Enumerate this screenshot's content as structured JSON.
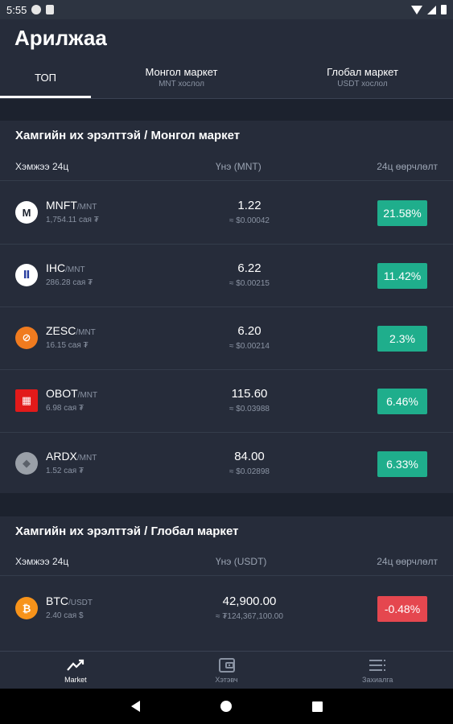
{
  "status_bar": {
    "time": "5:55"
  },
  "header": {
    "title": "Арилжаа"
  },
  "tabs": [
    {
      "label": "ТОП",
      "sub": ""
    },
    {
      "label": "Монгол маркет",
      "sub": "MNT хослол"
    },
    {
      "label": "Глобал маркет",
      "sub": "USDT хослол"
    }
  ],
  "sections": [
    {
      "title": "Хамгийн их эрэлттэй / Монгол маркет",
      "col_volume": "Хэмжээ 24ц",
      "col_price": "Үнэ (MNT)",
      "col_change": "24ц өөрчлөлт",
      "rows": [
        {
          "symbol": "MNFT",
          "pair": "/MNT",
          "volume": "1,754.11 сая ₮",
          "price": "1.22",
          "usd": "≈ $0.00042",
          "change": "21.58%",
          "direction": "up",
          "logo_icon": "mnft-logo-icon",
          "logo_bg": "#ffffff",
          "logo_fg": "#1c222e",
          "logo_glyph": "M"
        },
        {
          "symbol": "IHC",
          "pair": "/MNT",
          "volume": "286.28 сая ₮",
          "price": "6.22",
          "usd": "≈ $0.00215",
          "change": "11.42%",
          "direction": "up",
          "logo_icon": "ihc-logo-icon",
          "logo_bg": "#ffffff",
          "logo_fg": "#2a3fa0",
          "logo_glyph": "Ⅱ"
        },
        {
          "symbol": "ZESC",
          "pair": "/MNT",
          "volume": "16.15 сая ₮",
          "price": "6.20",
          "usd": "≈ $0.00214",
          "change": "2.3%",
          "direction": "up",
          "logo_icon": "zesc-logo-icon",
          "logo_bg": "#f07b1f",
          "logo_fg": "#ffffff",
          "logo_glyph": "⊘"
        },
        {
          "symbol": "OBOT",
          "pair": "/MNT",
          "volume": "6.98 сая ₮",
          "price": "115.60",
          "usd": "≈ $0.03988",
          "change": "6.46%",
          "direction": "up",
          "logo_icon": "obot-logo-icon",
          "logo_bg": "#e21a1a",
          "logo_fg": "#ffffff",
          "logo_glyph": "▦"
        },
        {
          "symbol": "ARDX",
          "pair": "/MNT",
          "volume": "1.52 сая ₮",
          "price": "84.00",
          "usd": "≈ $0.02898",
          "change": "6.33%",
          "direction": "up",
          "logo_icon": "ardx-logo-icon",
          "logo_bg": "#9aa0a8",
          "logo_fg": "#5b616a",
          "logo_glyph": "◆"
        }
      ]
    },
    {
      "title": "Хамгийн их эрэлттэй / Глобал маркет",
      "col_volume": "Хэмжээ 24ц",
      "col_price": "Үнэ (USDT)",
      "col_change": "24ц өөрчлөлт",
      "rows": [
        {
          "symbol": "BTC",
          "pair": "/USDT",
          "volume": "2.40 сая $",
          "price": "42,900.00",
          "usd": "≈ ₮124,367,100.00",
          "change": "-0.48%",
          "direction": "down",
          "logo_icon": "btc-logo-icon",
          "logo_bg": "#f7931a",
          "logo_fg": "#ffffff",
          "logo_glyph": "₿"
        }
      ]
    }
  ],
  "bottom_nav": [
    {
      "label": "Market",
      "icon": "chart-trend-icon"
    },
    {
      "label": "Хэтэвч",
      "icon": "wallet-icon"
    },
    {
      "label": "Захиалга",
      "icon": "list-icon"
    }
  ],
  "colors": {
    "up": "#1fae8c",
    "down": "#e5474f",
    "background": "#1c222e",
    "panel": "#262c3a"
  }
}
